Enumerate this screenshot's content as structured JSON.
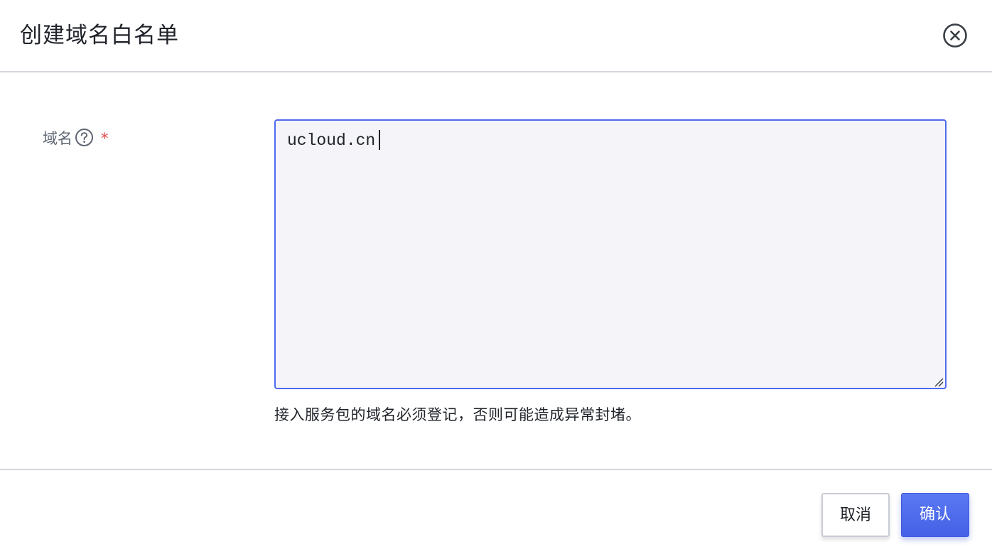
{
  "dialog": {
    "title": "创建域名白名单",
    "close_icon": "close-circle-icon"
  },
  "form": {
    "domain_field": {
      "label": "域名",
      "help_icon": "question-circle-icon",
      "required_mark": "*",
      "value": "ucloud.cn",
      "hint": "接入服务包的域名必须登记，否则可能造成异常封堵。"
    }
  },
  "footer": {
    "cancel_label": "取消",
    "confirm_label": "确认"
  },
  "colors": {
    "accent": "#4f6bed",
    "required": "#e5484d",
    "input_bg": "#f5f5f9"
  }
}
